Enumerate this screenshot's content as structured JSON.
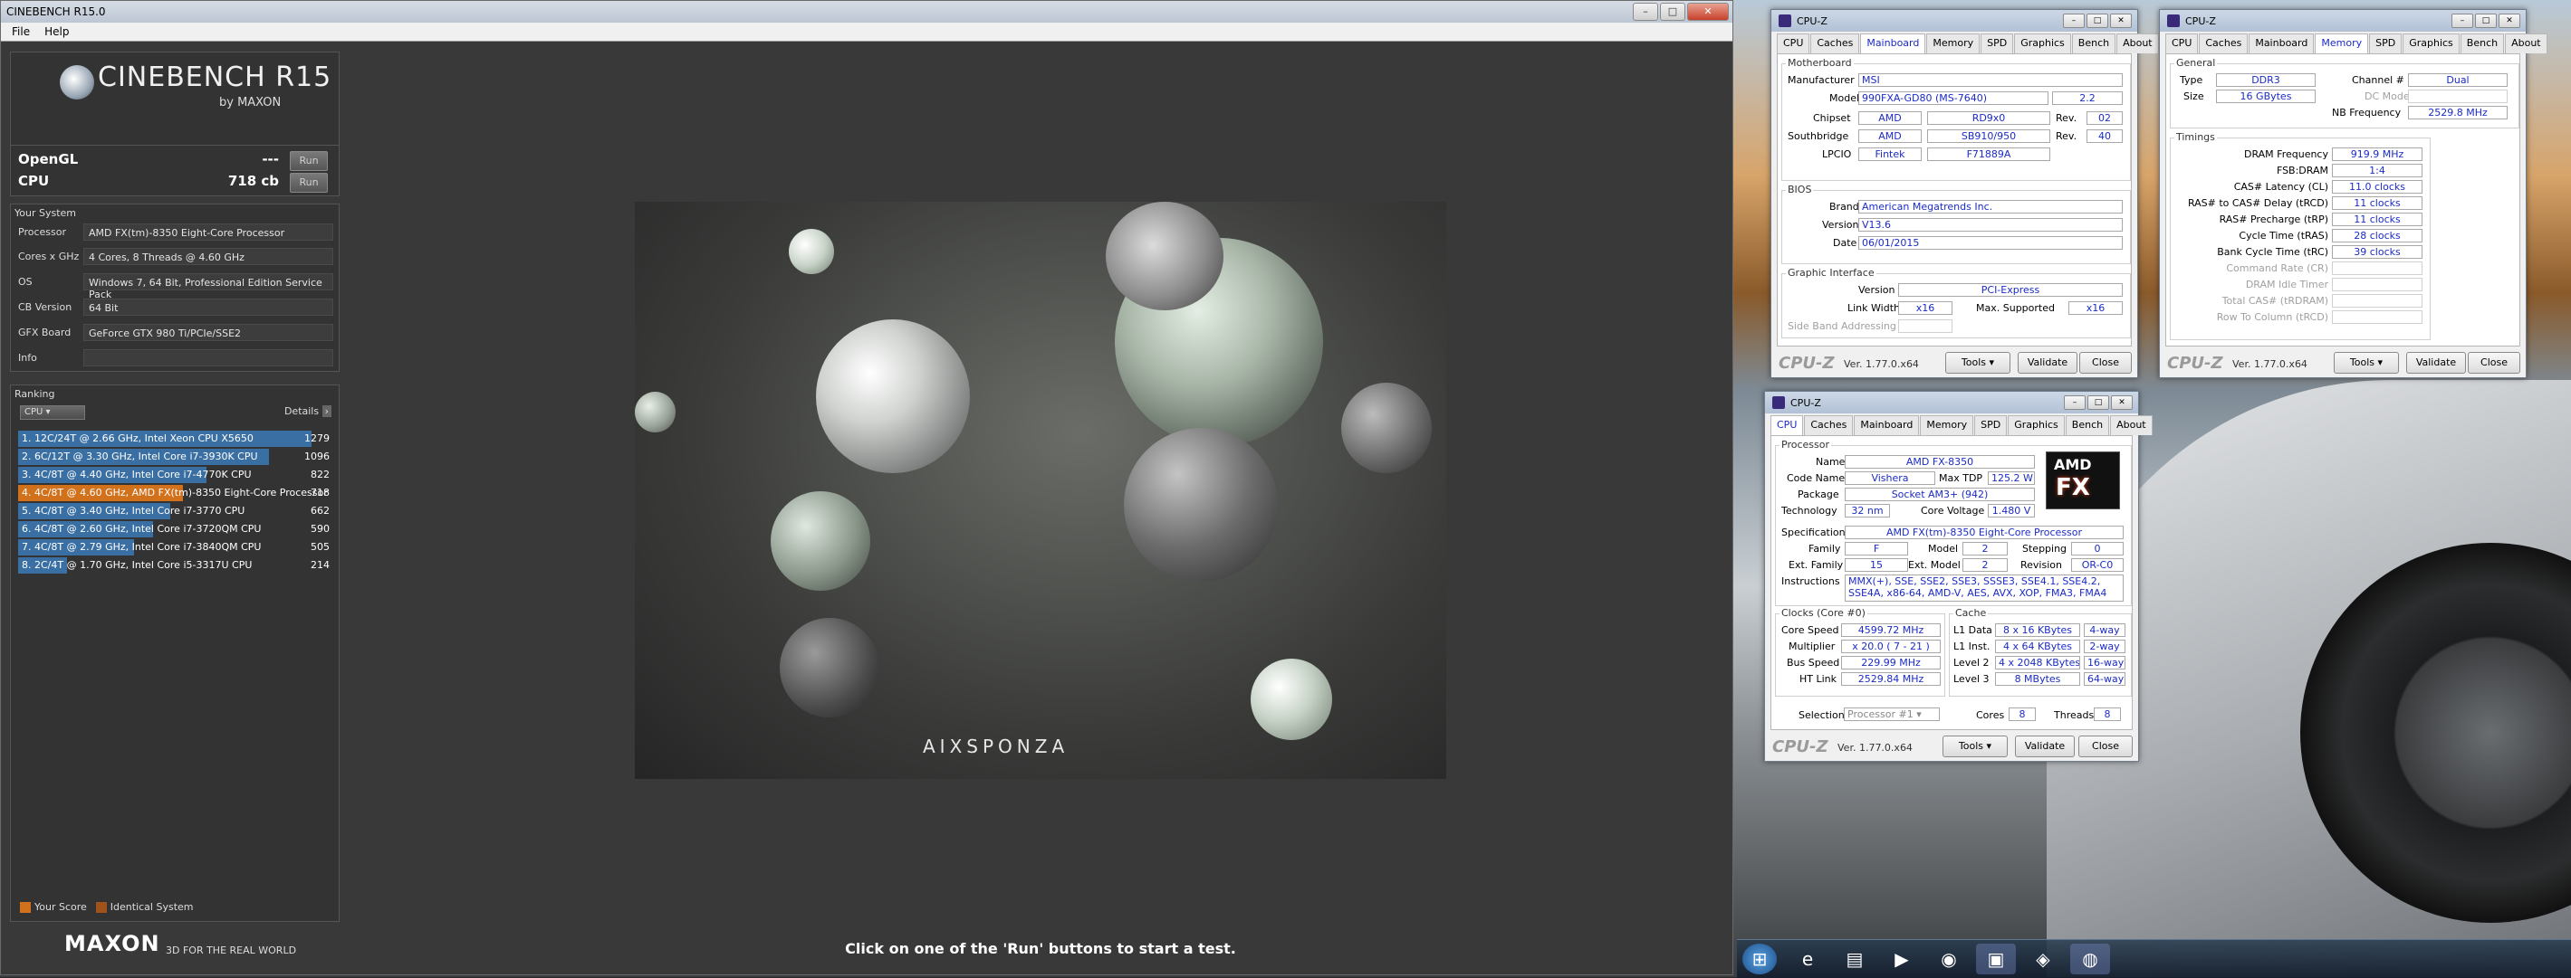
{
  "cinebench": {
    "title": "CINEBENCH R15.0",
    "menu": [
      "File",
      "Help"
    ],
    "logo_title": "CINEBENCH R15",
    "logo_sub": "by MAXON",
    "opengl_label": "OpenGL",
    "opengl_value": "---",
    "cpu_label": "CPU",
    "cpu_value": "718 cb",
    "run_label": "Run",
    "your_system_label": "Your System",
    "system": [
      {
        "k": "Processor",
        "v": "AMD FX(tm)-8350 Eight-Core Processor"
      },
      {
        "k": "Cores x GHz",
        "v": "4 Cores, 8 Threads @ 4.60 GHz"
      },
      {
        "k": "OS",
        "v": "Windows 7, 64 Bit, Professional Edition Service Pack"
      },
      {
        "k": "CB Version",
        "v": "64 Bit"
      },
      {
        "k": "GFX Board",
        "v": "GeForce GTX 980 Ti/PCIe/SSE2"
      },
      {
        "k": "Info",
        "v": ""
      }
    ],
    "ranking_label": "Ranking",
    "ranking_dropdown": "CPU",
    "details_label": "Details",
    "ranking": [
      {
        "label": "1. 12C/24T @ 2.66 GHz, Intel Xeon CPU X5650",
        "score": "1279",
        "value": 1279,
        "mine": false
      },
      {
        "label": "2. 6C/12T @ 3.30 GHz,  Intel Core i7-3930K CPU",
        "score": "1096",
        "value": 1096,
        "mine": false
      },
      {
        "label": "3. 4C/8T @ 4.40 GHz, Intel Core i7-4770K CPU",
        "score": "822",
        "value": 822,
        "mine": false
      },
      {
        "label": "4. 4C/8T @ 4.60 GHz, AMD FX(tm)-8350 Eight-Core Processor",
        "score": "718",
        "value": 718,
        "mine": true
      },
      {
        "label": "5. 4C/8T @ 3.40 GHz,  Intel Core i7-3770 CPU",
        "score": "662",
        "value": 662,
        "mine": false
      },
      {
        "label": "6. 4C/8T @ 2.60 GHz, Intel Core i7-3720QM CPU",
        "score": "590",
        "value": 590,
        "mine": false
      },
      {
        "label": "7. 4C/8T @ 2.79 GHz,  Intel Core i7-3840QM CPU",
        "score": "505",
        "value": 505,
        "mine": false
      },
      {
        "label": "8. 2C/4T @ 1.70 GHz,  Intel Core i5-3317U CPU",
        "score": "214",
        "value": 214,
        "mine": false
      }
    ],
    "legend_your_score": "Your Score",
    "legend_identical": "Identical System",
    "maxon": "MAXON",
    "tagline": "3D FOR THE REAL WORLD",
    "render_brand": "AIXSPONZA",
    "status": "Click on one of the 'Run' buttons to start a test.",
    "colors": {
      "bar": "#3a6fa3",
      "mine": "#d2711b",
      "identical": "#a0521c"
    }
  },
  "cpuz_common": {
    "title": "CPU-Z",
    "tabs": [
      "CPU",
      "Caches",
      "Mainboard",
      "Memory",
      "SPD",
      "Graphics",
      "Bench",
      "About"
    ],
    "logo": "CPU-Z",
    "version": "Ver. 1.77.0.x64",
    "tools": "Tools",
    "validate": "Validate",
    "close": "Close"
  },
  "mainboard": {
    "motherboard_label": "Motherboard",
    "manufacturer_k": "Manufacturer",
    "manufacturer": "MSI",
    "model_k": "Model",
    "model": "990FXA-GD80 (MS-7640)",
    "model_rev": "2.2",
    "chipset_k": "Chipset",
    "chipset_vendor": "AMD",
    "chipset": "RD9x0",
    "rev_k": "Rev.",
    "chipset_rev": "02",
    "south_k": "Southbridge",
    "south_vendor": "AMD",
    "south": "SB910/950",
    "south_rev": "40",
    "lpcio_k": "LPCIO",
    "lpcio_vendor": "Fintek",
    "lpcio": "F71889A",
    "bios_label": "BIOS",
    "brand_k": "Brand",
    "brand": "American Megatrends Inc.",
    "version_k": "Version",
    "version": "V13.6",
    "date_k": "Date",
    "date": "06/01/2015",
    "gi_label": "Graphic Interface",
    "gi_version_k": "Version",
    "gi_version": "PCI-Express",
    "link_k": "Link Width",
    "link": "x16",
    "max_k": "Max. Supported",
    "max": "x16",
    "sba_k": "Side Band Addressing"
  },
  "memory": {
    "general_label": "General",
    "type_k": "Type",
    "type": "DDR3",
    "size_k": "Size",
    "size": "16 GBytes",
    "channel_k": "Channel #",
    "channel": "Dual",
    "dcmode_k": "DC Mode",
    "nb_k": "NB Frequency",
    "nb": "2529.8 MHz",
    "timings_label": "Timings",
    "rows": [
      {
        "k": "DRAM Frequency",
        "v": "919.9 MHz",
        "dis": false
      },
      {
        "k": "FSB:DRAM",
        "v": "1:4",
        "dis": false
      },
      {
        "k": "CAS# Latency (CL)",
        "v": "11.0 clocks",
        "dis": false
      },
      {
        "k": "RAS# to CAS# Delay (tRCD)",
        "v": "11 clocks",
        "dis": false
      },
      {
        "k": "RAS# Precharge (tRP)",
        "v": "11 clocks",
        "dis": false
      },
      {
        "k": "Cycle Time (tRAS)",
        "v": "28 clocks",
        "dis": false
      },
      {
        "k": "Bank Cycle Time (tRC)",
        "v": "39 clocks",
        "dis": false
      },
      {
        "k": "Command Rate (CR)",
        "v": "",
        "dis": true
      },
      {
        "k": "DRAM Idle Timer",
        "v": "",
        "dis": true
      },
      {
        "k": "Total CAS# (tRDRAM)",
        "v": "",
        "dis": true
      },
      {
        "k": "Row To Column (tRCD)",
        "v": "",
        "dis": true
      }
    ]
  },
  "cpu": {
    "processor_label": "Processor",
    "name_k": "Name",
    "name": "AMD FX-8350",
    "code_k": "Code Name",
    "code": "Vishera",
    "tdp_k": "Max TDP",
    "tdp": "125.2 W",
    "package_k": "Package",
    "package": "Socket AM3+ (942)",
    "tech_k": "Technology",
    "tech": "32 nm",
    "volt_k": "Core Voltage",
    "volt": "1.480 V",
    "spec_k": "Specification",
    "spec": "AMD FX(tm)-8350 Eight-Core Processor",
    "family_k": "Family",
    "family": "F",
    "model_k": "Model",
    "model": "2",
    "stepping_k": "Stepping",
    "stepping": "0",
    "extfam_k": "Ext. Family",
    "extfam": "15",
    "extmod_k": "Ext. Model",
    "extmod": "2",
    "revision_k": "Revision",
    "revision": "OR-C0",
    "instr_k": "Instructions",
    "instr": "MMX(+), SSE, SSE2, SSE3, SSSE3, SSE4.1, SSE4.2, SSE4A, x86-64, AMD-V, AES, AVX, XOP, FMA3, FMA4",
    "clocks_label": "Clocks (Core #0)",
    "speed_k": "Core Speed",
    "speed": "4599.72 MHz",
    "mult_k": "Multiplier",
    "mult": "x 20.0 ( 7 - 21 )",
    "bus_k": "Bus Speed",
    "bus": "229.99 MHz",
    "ht_k": "HT Link",
    "ht": "2529.84 MHz",
    "cache_label": "Cache",
    "l1d_k": "L1 Data",
    "l1d": "8 x 16 KBytes",
    "l1d_w": "4-way",
    "l1i_k": "L1 Inst.",
    "l1i": "4 x 64 KBytes",
    "l1i_w": "2-way",
    "l2_k": "Level 2",
    "l2": "4 x 2048 KBytes",
    "l2_w": "16-way",
    "l3_k": "Level 3",
    "l3": "8 MBytes",
    "l3_w": "64-way",
    "selection_k": "Selection",
    "selection": "Processor #1",
    "cores_k": "Cores",
    "cores": "8",
    "threads_k": "Threads",
    "threads": "8",
    "amd_logo": "AMD",
    "fx_logo": "FX"
  }
}
